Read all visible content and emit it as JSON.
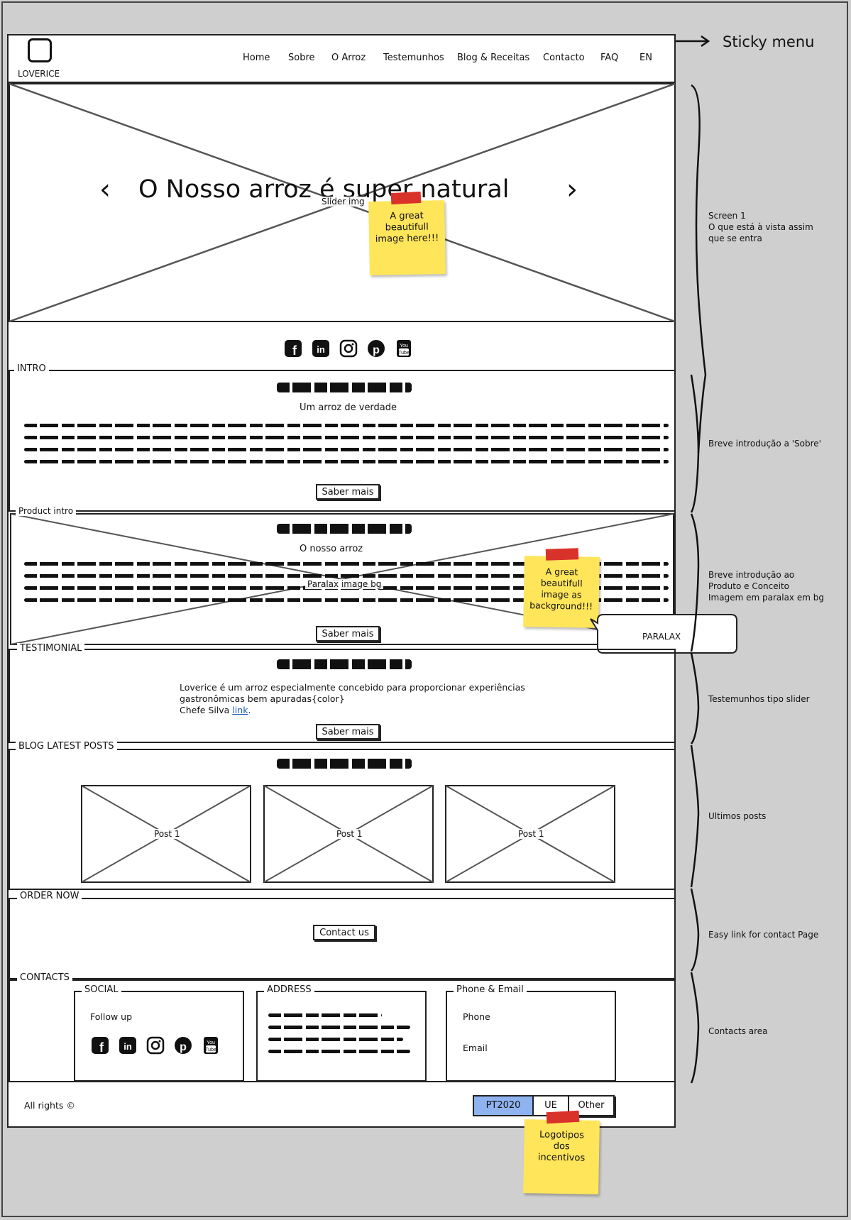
{
  "annotation_top": "Sticky menu",
  "header": {
    "logo_text": "LOVERICE",
    "nav": [
      "Home",
      "Sobre",
      "O Arroz",
      "Testemunhos",
      "Blog & Receitas",
      "Contacto",
      "FAQ",
      "EN"
    ]
  },
  "hero": {
    "title": "O Nosso arroz é super natural",
    "prev": "‹",
    "next": "›",
    "image_label": "Slider img",
    "sticky_note": [
      "A great",
      "beautifull",
      "image here!!!"
    ]
  },
  "intro": {
    "legend": "INTRO",
    "subtitle": "Um arroz de verdade",
    "button": "Saber mais"
  },
  "product": {
    "legend": "Product intro",
    "subtitle": "O nosso arroz",
    "image_label": "Paralax image bg",
    "button": "Saber mais",
    "sticky_note": [
      "A great",
      "beautifull",
      "image as",
      "background!!!"
    ],
    "callout": "PARALAX"
  },
  "testimonial": {
    "legend": "TESTIMONIAL",
    "quote_line1": "Loverice é um arroz especialmente concebido para proporcionar experiências",
    "quote_line2": "gastronômicas bem apuradas{color}",
    "author": "Chefe Silva",
    "link": "link",
    "period": ".",
    "button": "Saber mais"
  },
  "blog": {
    "legend": "BLOG LATEST POSTS",
    "posts": [
      "Post 1",
      "Post 1",
      "Post 1"
    ]
  },
  "order": {
    "legend": "ORDER NOW",
    "button": "Contact us"
  },
  "contacts": {
    "legend": "CONTACTS",
    "social": {
      "legend": "SOCIAL",
      "follow": "Follow up"
    },
    "address": {
      "legend": "ADDRESS"
    },
    "phone_email": {
      "legend": "Phone & Email",
      "phone": "Phone",
      "email": "Email"
    }
  },
  "footer": {
    "rights": "All rights ©",
    "segments": [
      "PT2020",
      "UE",
      "Other"
    ],
    "sticky_note": [
      "Logotipos",
      "dos",
      "incentivos"
    ]
  },
  "annotations": {
    "screen1": [
      "Screen 1",
      "O que está à vista assim",
      "que se entra"
    ],
    "intro": "Breve introdução a 'Sobre'",
    "product": [
      "Breve introdução ao",
      "Produto e Conceito",
      "Imagem em paralax em bg"
    ],
    "testimonial": "Testemunhos tipo slider",
    "blog": "Ultimos posts",
    "order": "Easy link for contact Page",
    "contacts": "Contacts area"
  },
  "social_icons": [
    "facebook-icon",
    "linkedin-icon",
    "instagram-icon",
    "pinterest-icon",
    "youtube-icon"
  ],
  "colors": {
    "sticky": "#ffe55a",
    "tape": "#d9322b",
    "selected_segment": "#8fb3f0",
    "link": "#1a55c0"
  }
}
